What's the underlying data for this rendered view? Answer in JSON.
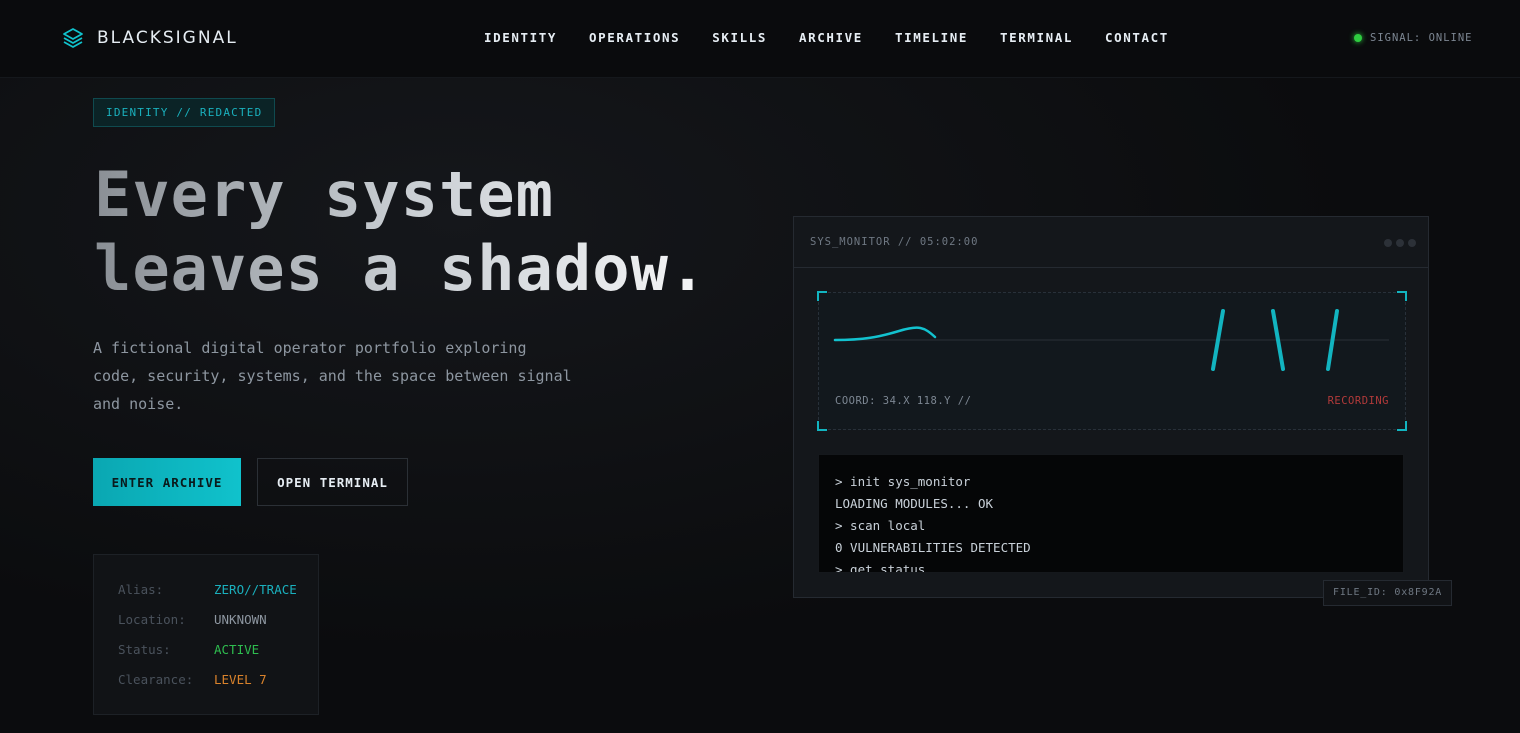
{
  "brand": {
    "name": "BLACKSIGNAL",
    "icon": "layers-icon",
    "accent": "#10c2cc"
  },
  "nav": {
    "items": [
      "IDENTITY",
      "OPERATIONS",
      "SKILLS",
      "ARCHIVE",
      "TIMELINE",
      "TERMINAL",
      "CONTACT"
    ]
  },
  "signal": {
    "text": "SIGNAL: ONLINE",
    "color": "#2ecc40"
  },
  "hero": {
    "tag": "IDENTITY // REDACTED",
    "headline_line1": "Every system",
    "headline_line2": "leaves a shadow.",
    "lede": "A fictional digital operator portfolio exploring code, security, systems, and the space between signal and noise.",
    "primary_cta": "ENTER ARCHIVE",
    "secondary_cta": "OPEN TERMINAL"
  },
  "identity_card": {
    "rows": [
      {
        "label": "Alias:",
        "value": "ZERO//TRACE",
        "color": "#1ab0bd"
      },
      {
        "label": "Location:",
        "value": "UNKNOWN",
        "color": "#8d96a0"
      },
      {
        "label": "Status:",
        "value": "ACTIVE",
        "color": "#2ebd4f"
      },
      {
        "label": "Clearance:",
        "value": "LEVEL 7",
        "color": "#d9822b"
      }
    ]
  },
  "monitor": {
    "title": "SYS_MONITOR // 05:02:00",
    "coord": "COORD: 34.X 118.Y //",
    "recording": "RECORDING",
    "recording_color": "#b23a3a",
    "console": [
      "> init sys_monitor",
      "LOADING MODULES... OK",
      "> scan local",
      "0 VULNERABILITIES DETECTED",
      "> get status"
    ],
    "file_id": "FILE_ID: 0x8F92A"
  }
}
